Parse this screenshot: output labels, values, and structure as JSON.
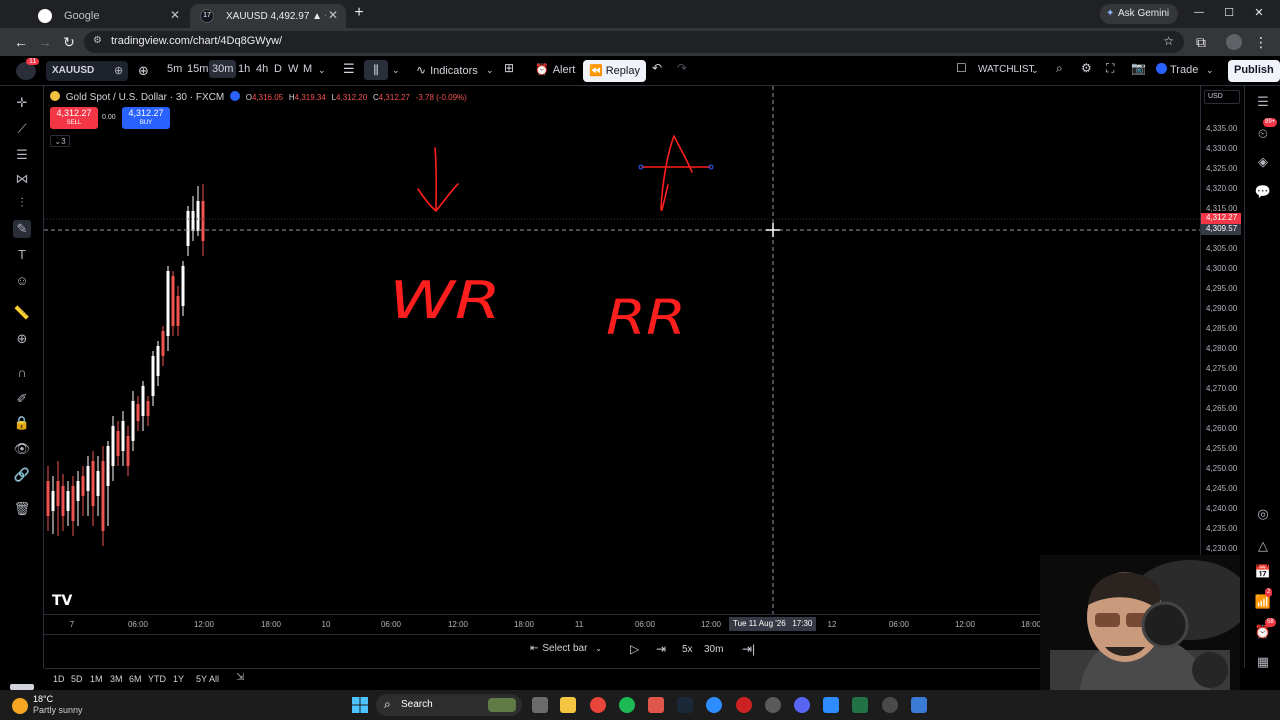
{
  "browser": {
    "tabs": [
      {
        "title": "Google",
        "active": false
      },
      {
        "title": "XAUUSD 4,492.97 ▲ +3.66% W",
        "active": true
      }
    ],
    "url": "tradingview.com/chart/4Dq8GWyw/",
    "ask_gemini": "Ask Gemini",
    "window_controls": [
      "—",
      "☐",
      "✕"
    ]
  },
  "toolbar": {
    "notification_count": "11",
    "symbol": "XAUUSD",
    "intervals": [
      "5m",
      "15m",
      "30m",
      "1h",
      "4h",
      "D",
      "W",
      "M"
    ],
    "active_interval": "30m",
    "indicators": "Indicators",
    "alert": "Alert",
    "replay": "Replay",
    "watchlist": "WATCHLIST",
    "trade": "Trade",
    "publish": "Publish"
  },
  "legend": {
    "title": "Gold Spot / U.S. Dollar · 30 · FXCM",
    "open_label": "O",
    "open": "4,316.05",
    "high_label": "H",
    "high": "4,319.34",
    "low_label": "L",
    "low": "4,312.20",
    "close_label": "C",
    "close": "4,312.27",
    "change": "-3.78 (-0.09%)",
    "sell_price": "4,312.27",
    "sell_label": "SELL",
    "spread": "0.00",
    "buy_price": "4,312.27",
    "buy_label": "BUY",
    "collapse_count": "3"
  },
  "drawings": {
    "text1": "WR",
    "text2": "RR"
  },
  "price_axis": {
    "currency": "USD",
    "labels": [
      "4,335.00",
      "4,330.00",
      "4,325.00",
      "4,320.00",
      "4,315.00",
      "4,305.00",
      "4,300.00",
      "4,295.00",
      "4,290.00",
      "4,285.00",
      "4,280.00",
      "4,275.00",
      "4,270.00",
      "4,265.00",
      "4,260.00",
      "4,255.00",
      "4,250.00",
      "4,245.00",
      "4,240.00",
      "4,235.00",
      "4,230.00",
      "4,225.00",
      "4,220.00",
      "4,215.00"
    ],
    "last_price": "4,312.27",
    "crosshair_price": "4,309.57"
  },
  "time_axis": {
    "labels": [
      "7",
      "06:00",
      "12:00",
      "18:00",
      "10",
      "06:00",
      "12:00",
      "18:00",
      "11",
      "06:00",
      "12:00",
      "12",
      "06:00",
      "12:00",
      "18:00"
    ],
    "crosshair_time": "Tue 11 Aug '26   17:30"
  },
  "replay_bar": {
    "select_bar": "Select bar",
    "speed": "5x",
    "interval": "30m"
  },
  "ranges": [
    "1D",
    "5D",
    "1M",
    "3M",
    "6M",
    "YTD",
    "1Y",
    "5Y",
    "All"
  ],
  "right_panel_badges": {
    "notifications": "99+",
    "alerts": "2",
    "messages": "58"
  },
  "taskbar": {
    "temperature": "18°C",
    "weather": "Partly sunny",
    "search": "Search"
  },
  "colors": {
    "bull": "#ffffff",
    "bear": "#ef5350",
    "drawing": "#ff1e1e",
    "accent": "#2962ff"
  }
}
